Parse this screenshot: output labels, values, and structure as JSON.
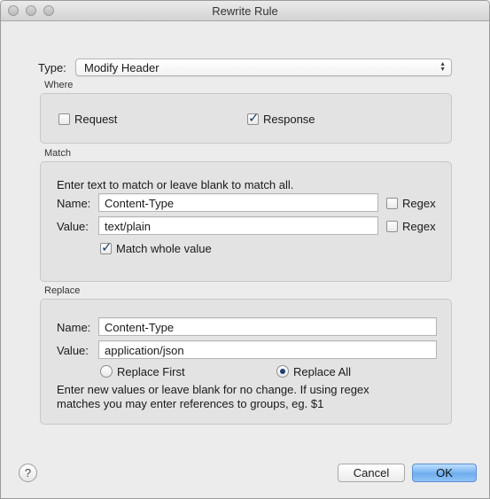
{
  "window": {
    "title": "Rewrite Rule"
  },
  "type": {
    "label": "Type:",
    "value": "Modify Header"
  },
  "where": {
    "section_label": "Where",
    "request": {
      "label": "Request",
      "checked": false
    },
    "response": {
      "label": "Response",
      "checked": true
    }
  },
  "match": {
    "section_label": "Match",
    "instruction": "Enter text to match or leave blank to match all.",
    "name_label": "Name:",
    "name_value": "Content-Type",
    "name_regex_label": "Regex",
    "value_label": "Value:",
    "value_value": "text/plain",
    "value_regex_label": "Regex",
    "whole_value_label": "Match whole value",
    "whole_value_checked": true
  },
  "replace": {
    "section_label": "Replace",
    "name_label": "Name:",
    "name_value": "Content-Type",
    "value_label": "Value:",
    "value_value": "application/json",
    "replace_first_label": "Replace First",
    "replace_all_label": "Replace All",
    "selected": "Replace All",
    "help_line1": "Enter new values or leave blank for no change. If using regex",
    "help_line2": "matches you may enter references to groups, eg. $1"
  },
  "footer": {
    "help_glyph": "?",
    "cancel_label": "Cancel",
    "ok_label": "OK"
  },
  "colors": {
    "accent": "#1d3f6e",
    "default_button": "#6faeef"
  }
}
